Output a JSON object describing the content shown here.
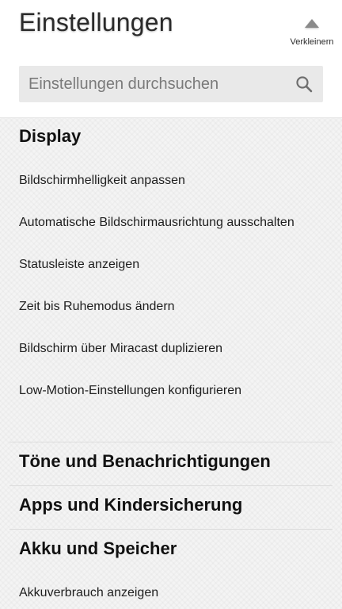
{
  "header": {
    "title": "Einstellungen",
    "collapse_label": "Verkleinern"
  },
  "search": {
    "placeholder": "Einstellungen durchsuchen",
    "icon": "search-icon"
  },
  "sections": {
    "display": {
      "title": "Display",
      "items": [
        "Bildschirmhelligkeit anpassen",
        "Automatische Bildschirmausrichtung ausschalten",
        "Statusleiste anzeigen",
        "Zeit bis Ruhemodus ändern",
        "Bildschirm über Miracast duplizieren",
        "Low-Motion-Einstellungen konfigurieren"
      ]
    },
    "sounds": {
      "title": "Töne und Benachrichtigungen"
    },
    "apps": {
      "title": "Apps und Kindersicherung"
    },
    "battery": {
      "title": "Akku und Speicher",
      "items": [
        "Akkuverbrauch anzeigen"
      ]
    }
  }
}
